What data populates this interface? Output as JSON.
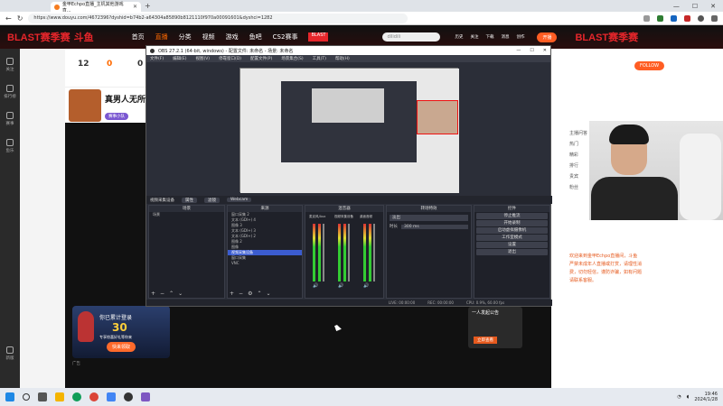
{
  "browser": {
    "tab_title": "金甲Echpo直播_主机其他游戏直...",
    "url": "https://www.douyu.com/4672396?dyshid=b74b2-a64304a85890b8121110f970a00091601&dyshci=1282"
  },
  "site": {
    "logo": "BLAST赛季赛",
    "logo_accent": "斗鱼",
    "nav": [
      "首页",
      "直播",
      "分类",
      "视频",
      "游戏",
      "鱼吧",
      "CS2赛事"
    ],
    "nav_active": "直播",
    "promo": "BLAST",
    "search_placeholder": "dilidili",
    "header_icons": [
      "历史",
      "关注",
      "下载",
      "消息",
      "创作"
    ],
    "open_button": "开播",
    "right_logo": "BLAST赛季赛"
  },
  "left_rail": [
    "关注",
    "排行榜",
    "赛事",
    "鱼乐",
    "新版"
  ],
  "room": {
    "stats": [
      "12",
      "0",
      "0",
      "0"
    ],
    "title": "真男人无所畏",
    "tag": "赛事小队",
    "follow_button": "FOLLOW"
  },
  "ad": {
    "title": "你已累计登录",
    "days": "30",
    "unit": "天",
    "subtitle": "专享惊喜好礼等你来",
    "button": "快来领取",
    "label": "广告"
  },
  "chat": {
    "lines": [
      "主播问答",
      "热门",
      "精彩",
      "排行",
      "贵宾",
      "粉丝"
    ],
    "system": "欢迎来到金甲Echpo直播间，斗鱼严禁未成年人直播或打赏，请理性消费，切勿轻信，谨防诈骗，如有问题请联系客服。"
  },
  "notice": {
    "title": "一人发起公告",
    "button": "立即查看"
  },
  "obs": {
    "title": "OBS 27.2.1 (64-bit, windows) - 配置文件: 未命名 - 场景: 未命名",
    "menu": [
      "文件(F)",
      "编辑(E)",
      "视图(V)",
      "停靠窗口(D)",
      "配置文件(P)",
      "场景集合(S)",
      "工具(T)",
      "帮助(H)"
    ],
    "source_bar": {
      "source": "视频采集设备",
      "props": "属性",
      "filters": "滤镜",
      "device": "Webcam"
    },
    "docks": {
      "scenes": "场景",
      "sources": "来源",
      "mixer": "混音器",
      "transitions": "转场特效",
      "controls": "控件"
    },
    "scene_list": [
      "场景"
    ],
    "source_list": [
      "窗口采集 2",
      "文本 (GDI+) 4",
      "图像 3",
      "文本 (GDI+) 3",
      "文本 (GDI+) 2",
      "图像 2",
      "图像",
      "视频采集设备",
      "窗口采集",
      "VNC"
    ],
    "mixer_channels": [
      "麦克风/Aux",
      "视频采集设备",
      "桌面音频"
    ],
    "transition_type": "淡出",
    "duration_label": "时长",
    "duration_value": "300 ms",
    "control_buttons": [
      "停止推流",
      "开始录制",
      "启动虚拟摄像机",
      "工作室模式",
      "设置",
      "退出"
    ],
    "status": [
      "LIVE: 00:00:00",
      "REC: 00:00:00",
      "CPU: 0.9%, 60.00 fps"
    ]
  },
  "taskbar": {
    "time": "19:46",
    "date": "2024/1/28",
    "apps": [
      "start",
      "search",
      "files",
      "edge",
      "chrome",
      "store",
      "obs"
    ]
  }
}
